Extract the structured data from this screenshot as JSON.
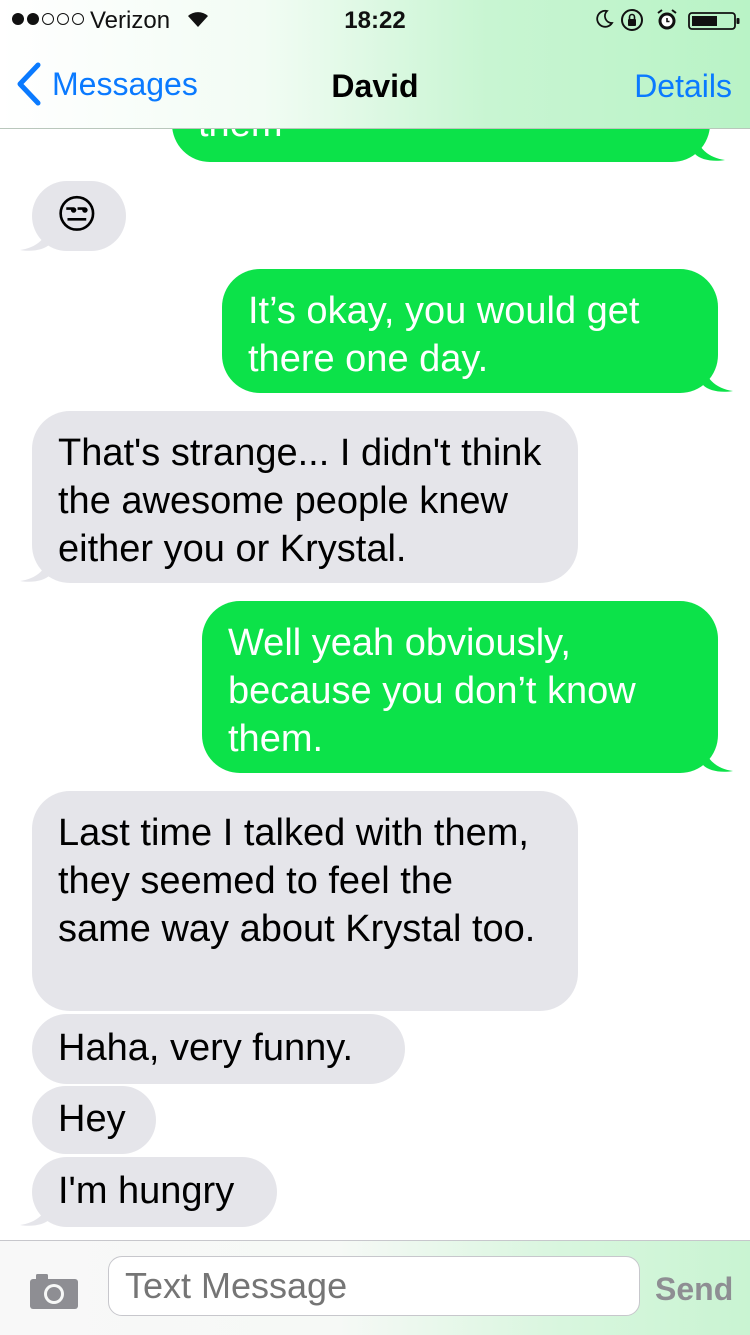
{
  "status_bar": {
    "carrier": "Verizon",
    "time": "18:22",
    "signal_bars_filled": 2,
    "signal_bars_total": 5
  },
  "nav": {
    "back_label": "Messages",
    "title": "David",
    "details_label": "Details"
  },
  "messages": [
    {
      "from": "me",
      "text": "them",
      "partial": true
    },
    {
      "from": "them",
      "text": "😒"
    },
    {
      "from": "me",
      "text": "It’s okay, you would get there one day."
    },
    {
      "from": "them",
      "text": "That's strange... I didn't think the awesome people knew either you or Krystal."
    },
    {
      "from": "me",
      "text": "Well yeah obviously, because you don’t know them."
    },
    {
      "from": "them",
      "text": "Last time I talked with them, they seemed to feel the same way about Krystal too."
    },
    {
      "from": "them",
      "text": "Haha, very funny."
    },
    {
      "from": "them",
      "text": "Hey"
    },
    {
      "from": "them",
      "text": "I'm hungry"
    }
  ],
  "composer": {
    "placeholder": "Text Message",
    "send_label": "Send"
  },
  "colors": {
    "outgoing_bubble": "#0ce249",
    "incoming_bubble": "#e5e5ea",
    "link_blue": "#0a7aff",
    "send_gray": "#8e8e93"
  },
  "icons": [
    "chevron-left-icon",
    "wifi-icon",
    "moon-icon",
    "rotation-lock-icon",
    "alarm-icon",
    "battery-icon",
    "camera-icon"
  ]
}
